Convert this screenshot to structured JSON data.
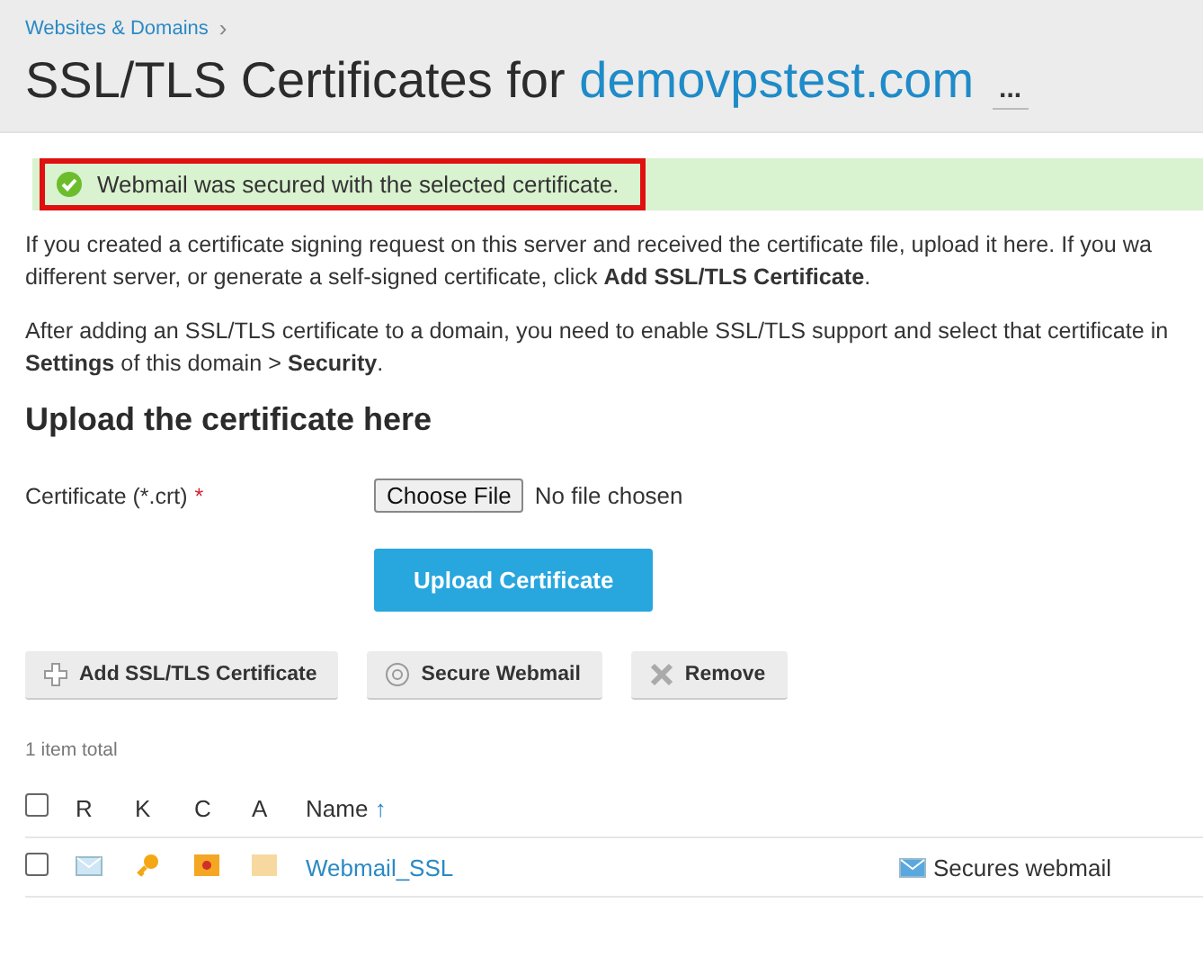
{
  "breadcrumb": {
    "label": "Websites & Domains",
    "separator": "›"
  },
  "title": {
    "prefix": "SSL/TLS Certificates for",
    "domain": "demovpstest.com",
    "menu": "..."
  },
  "message": {
    "kind": "success",
    "text": "Webmail was secured with the selected certificate.",
    "highlighted": true
  },
  "paragraphs": [
    {
      "lines": [
        "If you created a certificate signing request on this server and received the certificate file, upload it here. If you wa",
        "different server, or generate a self-signed certificate, click **Add SSL/TLS Certificate**."
      ]
    },
    {
      "lines": [
        "After adding an SSL/TLS certificate to a domain, you need to enable SSL/TLS support and select that certificate in",
        "**Settings** of this domain > **Security**."
      ]
    }
  ],
  "upload": {
    "heading": "Upload the certificate here",
    "field_label": "Certificate (*.crt)",
    "required_mark": "*",
    "choose_button": "Choose File",
    "file_status": "No file chosen",
    "submit": "Upload Certificate"
  },
  "toolbar": [
    {
      "kind": "add",
      "label": "Add SSL/TLS Certificate"
    },
    {
      "kind": "secure",
      "label": "Secure Webmail"
    },
    {
      "kind": "remove",
      "label": "Remove"
    }
  ],
  "table": {
    "count": "1 item total",
    "columns": [
      {
        "label": "R"
      },
      {
        "label": "K"
      },
      {
        "label": "C"
      },
      {
        "label": "A"
      },
      {
        "label": "Name",
        "sort": "↑"
      }
    ],
    "rows": [
      {
        "checked": false,
        "name": "Webmail_SSL",
        "usage": "Secures webmail"
      }
    ],
    "header_checked": false
  }
}
